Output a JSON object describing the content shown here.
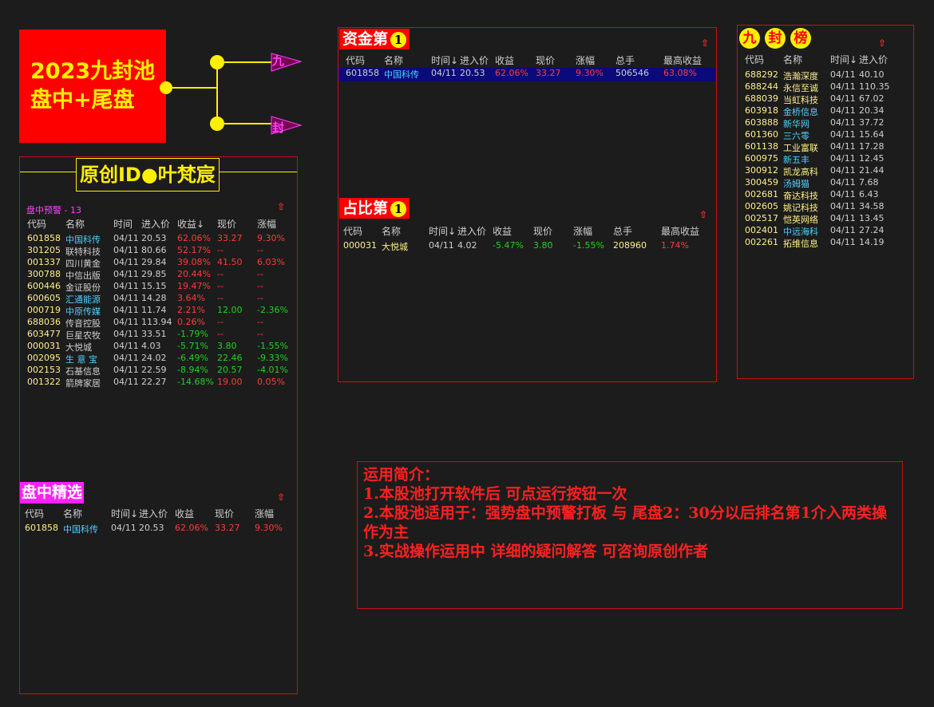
{
  "logo": {
    "line1": "2023九封池",
    "line2": "盘中+尾盘",
    "branch_top": "九",
    "branch_bottom": "封"
  },
  "author": {
    "label": "原创ID●叶梵宸"
  },
  "alert_panel": {
    "title": "盘中预警 - 13",
    "headers": [
      "代码",
      "名称",
      "时间",
      "进入价",
      "收益↓",
      "现价",
      "涨幅"
    ],
    "rows": [
      {
        "code": "601858",
        "name": "中国科传",
        "time": "04/11",
        "entry": "20.53",
        "gain": "62.06%",
        "price": "33.27",
        "chg": "9.30%",
        "nc": "cy",
        "gc": "up",
        "pc": "up",
        "cc": "up"
      },
      {
        "code": "301205",
        "name": "联特科技",
        "time": "04/11",
        "entry": "80.66",
        "gain": "52.17%",
        "price": "--",
        "chg": "--",
        "nc": "wh",
        "gc": "up",
        "pc": "up",
        "cc": "up"
      },
      {
        "code": "001337",
        "name": "四川黄金",
        "time": "04/11",
        "entry": "29.84",
        "gain": "39.08%",
        "price": "41.50",
        "chg": "6.03%",
        "nc": "wh",
        "gc": "up",
        "pc": "up",
        "cc": "up"
      },
      {
        "code": "300788",
        "name": "中信出版",
        "time": "04/11",
        "entry": "29.85",
        "gain": "20.44%",
        "price": "--",
        "chg": "--",
        "nc": "wh",
        "gc": "up",
        "pc": "up",
        "cc": "up"
      },
      {
        "code": "600446",
        "name": "金证股份",
        "time": "04/11",
        "entry": "15.15",
        "gain": "19.47%",
        "price": "--",
        "chg": "--",
        "nc": "wh",
        "gc": "up",
        "pc": "up",
        "cc": "up"
      },
      {
        "code": "600605",
        "name": "汇通能源",
        "time": "04/11",
        "entry": "14.28",
        "gain": "3.64%",
        "price": "--",
        "chg": "--",
        "nc": "cy",
        "gc": "up",
        "pc": "up",
        "cc": "up"
      },
      {
        "code": "000719",
        "name": "中原传媒",
        "time": "04/11",
        "entry": "11.74",
        "gain": "2.21%",
        "price": "12.00",
        "chg": "-2.36%",
        "nc": "cy",
        "gc": "up",
        "pc": "dn",
        "cc": "dn"
      },
      {
        "code": "688036",
        "name": "传音控股",
        "time": "04/11",
        "entry": "113.94",
        "gain": "0.26%",
        "price": "--",
        "chg": "--",
        "nc": "wh",
        "gc": "up",
        "pc": "up",
        "cc": "up"
      },
      {
        "code": "603477",
        "name": "巨星农牧",
        "time": "04/11",
        "entry": "33.51",
        "gain": "-1.79%",
        "price": "--",
        "chg": "--",
        "nc": "wh",
        "gc": "dn",
        "pc": "up",
        "cc": "up"
      },
      {
        "code": "000031",
        "name": "大悦城",
        "time": "04/11",
        "entry": "4.03",
        "gain": "-5.71%",
        "price": "3.80",
        "chg": "-1.55%",
        "nc": "wh",
        "gc": "dn",
        "pc": "dn",
        "cc": "dn"
      },
      {
        "code": "002095",
        "name": "生 意 宝",
        "time": "04/11",
        "entry": "24.02",
        "gain": "-6.49%",
        "price": "22.46",
        "chg": "-9.33%",
        "nc": "cy",
        "gc": "dn",
        "pc": "dn",
        "cc": "dn"
      },
      {
        "code": "002153",
        "name": "石基信息",
        "time": "04/11",
        "entry": "22.59",
        "gain": "-8.94%",
        "price": "20.57",
        "chg": "-4.01%",
        "nc": "wh",
        "gc": "dn",
        "pc": "dn",
        "cc": "dn"
      },
      {
        "code": "001322",
        "name": "箭牌家居",
        "time": "04/11",
        "entry": "22.27",
        "gain": "-14.68%",
        "price": "19.00",
        "chg": "0.05%",
        "nc": "wh",
        "gc": "dn",
        "pc": "up",
        "cc": "up"
      }
    ]
  },
  "select_panel": {
    "title": "盘中精选",
    "headers": [
      "代码",
      "名称",
      "时间↓",
      "进入价",
      "收益",
      "现价",
      "涨幅"
    ],
    "rows": [
      {
        "code": "601858",
        "name": "中国科传",
        "time": "04/11",
        "entry": "20.53",
        "gain": "62.06%",
        "price": "33.27",
        "chg": "9.30%"
      }
    ]
  },
  "fund_panel": {
    "title": "资金第",
    "num": "1",
    "headers": [
      "代码",
      "名称",
      "时间↓",
      "进入价",
      "收益",
      "现价",
      "涨幅",
      "总手",
      "最高收益"
    ],
    "rows": [
      {
        "code": "601858",
        "name": "中国科传",
        "time": "04/11",
        "entry": "20.53",
        "gain": "62.06%",
        "price": "33.27",
        "chg": "9.30%",
        "vol": "506546",
        "max": "63.08%"
      }
    ]
  },
  "ratio_panel": {
    "title": "占比第",
    "num": "1",
    "headers": [
      "代码",
      "名称",
      "时间↓",
      "进入价",
      "收益",
      "现价",
      "涨幅",
      "总手",
      "最高收益"
    ],
    "rows": [
      {
        "code": "000031",
        "name": "大悦城",
        "time": "04/11",
        "entry": "4.02",
        "gain": "-5.47%",
        "price": "3.80",
        "chg": "-1.55%",
        "vol": "208960",
        "max": "1.74%"
      }
    ]
  },
  "nine_panel": {
    "title_chars": [
      "九",
      "封",
      "榜"
    ],
    "headers": [
      "代码",
      "名称",
      "时间↓",
      "进入价"
    ],
    "rows": [
      {
        "code": "688292",
        "name": "浩瀚深度",
        "time": "04/11",
        "entry": "40.10",
        "nc": "wh"
      },
      {
        "code": "688244",
        "name": "永信至诚",
        "time": "04/11",
        "entry": "110.35",
        "nc": "wh"
      },
      {
        "code": "688039",
        "name": "当虹科技",
        "time": "04/11",
        "entry": "67.02",
        "nc": "wh"
      },
      {
        "code": "603918",
        "name": "金桥信息",
        "time": "04/11",
        "entry": "20.34",
        "nc": "cy"
      },
      {
        "code": "603888",
        "name": "新华网",
        "time": "04/11",
        "entry": "37.72",
        "nc": "cy"
      },
      {
        "code": "601360",
        "name": "三六零",
        "time": "04/11",
        "entry": "15.64",
        "nc": "cy"
      },
      {
        "code": "601138",
        "name": "工业富联",
        "time": "04/11",
        "entry": "17.28",
        "nc": "wh"
      },
      {
        "code": "600975",
        "name": "新五丰",
        "time": "04/11",
        "entry": "12.45",
        "nc": "cy"
      },
      {
        "code": "300912",
        "name": "凯龙高科",
        "time": "04/11",
        "entry": "21.44",
        "nc": "wh"
      },
      {
        "code": "300459",
        "name": "汤姆猫",
        "time": "04/11",
        "entry": "7.68",
        "nc": "cy"
      },
      {
        "code": "002681",
        "name": "奋达科技",
        "time": "04/11",
        "entry": "6.43",
        "nc": "wh"
      },
      {
        "code": "002605",
        "name": "姚记科技",
        "time": "04/11",
        "entry": "34.58",
        "nc": "wh"
      },
      {
        "code": "002517",
        "name": "恺英网络",
        "time": "04/11",
        "entry": "13.45",
        "nc": "wh"
      },
      {
        "code": "002401",
        "name": "中远海科",
        "time": "04/11",
        "entry": "27.24",
        "nc": "cy"
      },
      {
        "code": "002261",
        "name": "拓维信息",
        "time": "04/11",
        "entry": "14.19",
        "nc": "wh"
      }
    ]
  },
  "intro": {
    "lines": [
      "运用简介：",
      "1.本股池打开软件后 可点运行按钮一次",
      "2.本股池适用于：强势盘中预警打板 与 尾盘2：30分以后排名第1介入两类操作为主",
      "3.实战操作运用中 详细的疑问解答 可咨询原创作者"
    ]
  },
  "colors": {
    "bg": "#1c1c1c",
    "border": "#c8101a",
    "up": "#ff3b3b",
    "down": "#22d022",
    "accent": "#ffef00"
  }
}
